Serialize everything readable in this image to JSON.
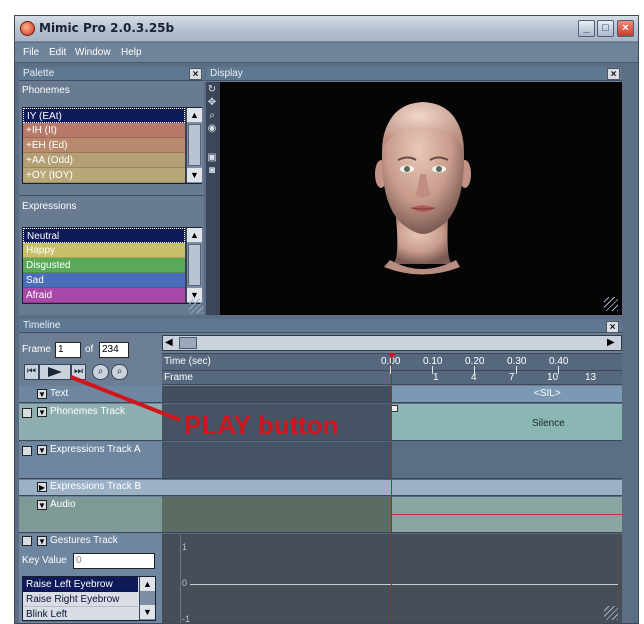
{
  "window": {
    "title": "Mimic Pro 2.0.3.25b",
    "buttons": {
      "minimize": "_",
      "maximize": "□",
      "close": "×"
    }
  },
  "menu": [
    "File",
    "Edit",
    "Window",
    "Help"
  ],
  "palette": {
    "title": "Palette",
    "phonemes_label": "Phonemes",
    "phonemes": [
      {
        "label": "IY (EAt)",
        "color": "#0e1a5a"
      },
      {
        "label": "+IH (It)",
        "color": "#b9796a"
      },
      {
        "label": "+EH (Ed)",
        "color": "#b9896e"
      },
      {
        "label": "+AA (Odd)",
        "color": "#b4a074"
      },
      {
        "label": "+OY (tOY)",
        "color": "#b8a878"
      }
    ],
    "expressions_label": "Expressions",
    "expressions": [
      {
        "label": "Neutral",
        "color": "#0e1a5a"
      },
      {
        "label": "Happy",
        "color": "#c9c06a"
      },
      {
        "label": "Disgusted",
        "color": "#58a958"
      },
      {
        "label": "Sad",
        "color": "#4a6fb8"
      },
      {
        "label": "Afraid",
        "color": "#a848a8"
      }
    ]
  },
  "display": {
    "title": "Display",
    "tools": [
      "rotate-icon",
      "pan-icon",
      "zoom-icon",
      "target-icon",
      "camera-icon",
      "reset-icon"
    ]
  },
  "timeline": {
    "title": "Timeline",
    "frame_label": "Frame",
    "frame_value": "1",
    "of_label": "of",
    "total_frames": "234",
    "time_label": "Time (sec)",
    "frame_row_label": "Frame",
    "time_ticks": [
      "0.00",
      "0.10",
      "0.20",
      "0.30",
      "0.40"
    ],
    "frame_ticks": [
      "1",
      "4",
      "7",
      "10",
      "13",
      "1"
    ],
    "tracks": {
      "text": "Text",
      "phonemes": "Phonemes Track",
      "expressions_a": "Expressions Track A",
      "expressions_b": "Expressions Track B",
      "audio": "Audio",
      "gestures": "Gestures Track"
    },
    "text_value": "<SIL>",
    "phoneme_value": "Silence",
    "key_value_label": "Key Value",
    "key_value": "0",
    "gestures": [
      "Raise Left Eyebrow",
      "Raise Right Eyebrow",
      "Blink Left"
    ],
    "graph_labels": [
      "1",
      "0",
      "-1"
    ]
  },
  "annotation": {
    "text": "PLAY button",
    "color": "#d0161c"
  }
}
